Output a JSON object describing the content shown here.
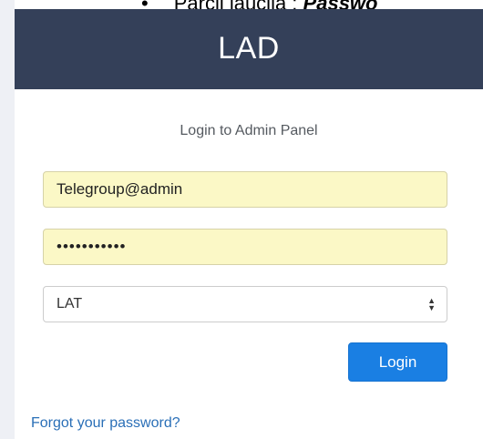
{
  "doc_snippet": {
    "bullet": "•",
    "label": "Parcii laučija : ",
    "bold": "Passwo"
  },
  "header": {
    "brand": "LAD"
  },
  "form": {
    "subtitle": "Login to Admin Panel",
    "username_value": "Telegroup@admin",
    "password_masked": "•••••••••••",
    "language_selected": "LAT",
    "login_label": "Login",
    "forgot_label": "Forgot your password?"
  },
  "colors": {
    "header_bg": "#344059",
    "autofill_bg": "#fbf8c6",
    "button_bg": "#1a7fe3",
    "link": "#2a6fb7"
  }
}
